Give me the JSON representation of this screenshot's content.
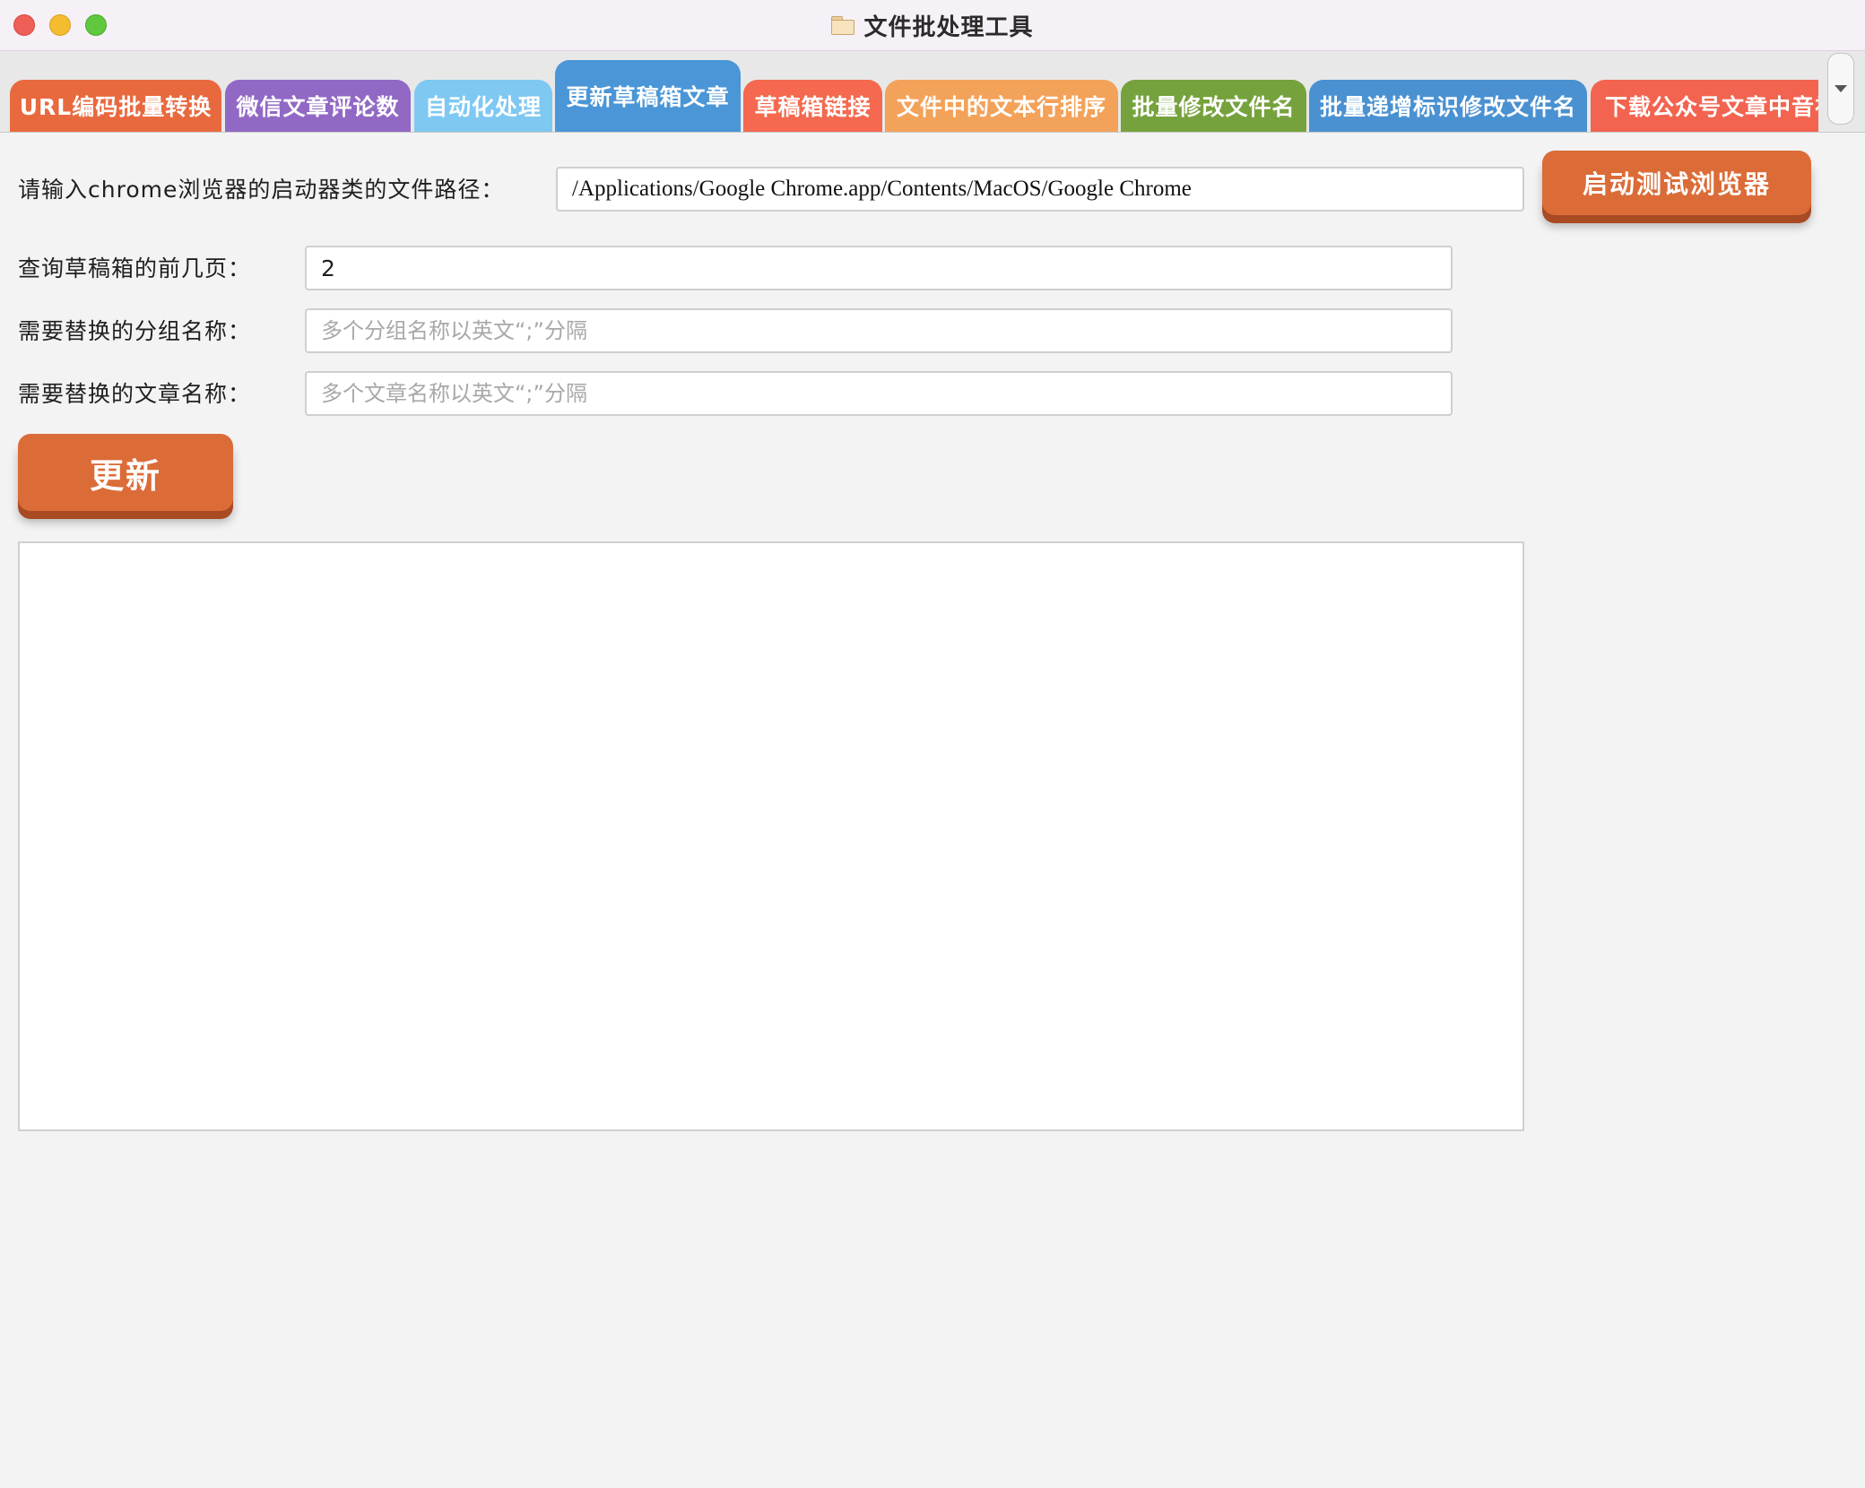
{
  "window": {
    "title": "文件批处理工具",
    "title_icon": "folder-icon"
  },
  "tabs": [
    {
      "label": "URL编码批量转换",
      "color": "#e9693f",
      "active": false
    },
    {
      "label": "微信文章评论数",
      "color": "#9169c4",
      "active": false
    },
    {
      "label": "自动化处理",
      "color": "#7ec8f2",
      "active": false
    },
    {
      "label": "更新草稿箱文章",
      "color": "#4a96d6",
      "active": true
    },
    {
      "label": "草稿箱链接",
      "color": "#f4694f",
      "active": false
    },
    {
      "label": "文件中的文本行排序",
      "color": "#f3a25a",
      "active": false
    },
    {
      "label": "批量修改文件名",
      "color": "#76a23d",
      "active": false
    },
    {
      "label": "批量递增标识修改文件名",
      "color": "#4a91d2",
      "active": false
    },
    {
      "label": "下载公众号文章中音视",
      "color": "#f26450",
      "active": false
    }
  ],
  "form": {
    "chrome_path_label": "请输入chrome浏览器的启动器类的文件路径：",
    "chrome_path_value": "/Applications/Google Chrome.app/Contents/MacOS/Google Chrome",
    "launch_button": "启动测试浏览器",
    "pages_label": "查询草稿箱的前几页：",
    "pages_value": "2",
    "group_label": "需要替换的分组名称：",
    "group_placeholder": "多个分组名称以英文“;”分隔",
    "article_label": "需要替换的文章名称：",
    "article_placeholder": "多个文章名称以英文“;”分隔",
    "update_button": "更新"
  },
  "output": {
    "content": ""
  },
  "colors": {
    "button_orange": "#db6c38",
    "button_shadow": "#a84a22"
  }
}
